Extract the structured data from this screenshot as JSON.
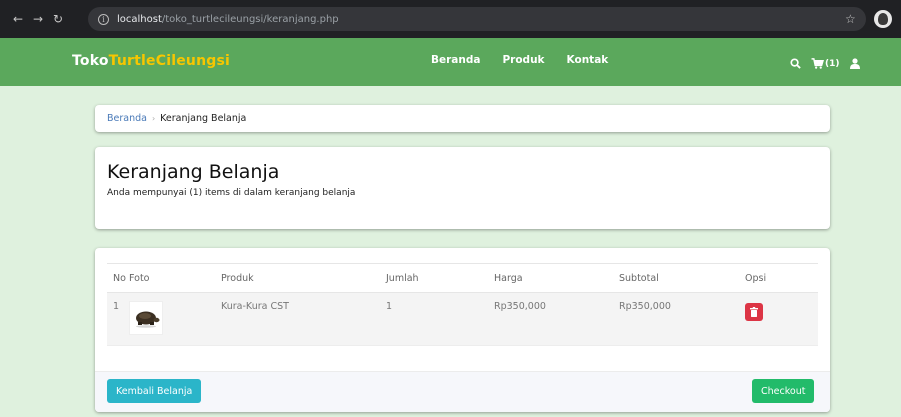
{
  "browser": {
    "url_host": "localhost",
    "url_path": "/toko_turtlecileungsi/keranjang.php"
  },
  "navbar": {
    "brand_part1": "Toko",
    "brand_part2": "TurtleCileungsi",
    "menu": [
      "Beranda",
      "Produk",
      "Kontak"
    ],
    "cart_count": "(1)"
  },
  "breadcrumb": {
    "home": "Beranda",
    "current": "Keranjang Belanja"
  },
  "page": {
    "title": "Keranjang Belanja",
    "subtitle": "Anda mempunyai (1) items di dalam keranjang belanja"
  },
  "table": {
    "headers": [
      "No",
      "Foto",
      "Produk",
      "Jumlah",
      "Harga",
      "Subtotal",
      "Opsi"
    ],
    "rows": [
      {
        "no": "1",
        "produk": "Kura-Kura CST",
        "jumlah": "1",
        "harga": "Rp350,000",
        "subtotal": "Rp350,000"
      }
    ]
  },
  "buttons": {
    "back": "Kembali Belanja",
    "checkout": "Checkout"
  },
  "colors": {
    "navbar": "#5ba85c",
    "brand_accent": "#f7c600",
    "page_bg": "#dff1de",
    "delete": "#dc3545",
    "back_button": "#2bb5c9",
    "checkout_button": "#22bb6a"
  },
  "icons": {
    "search": "search-icon",
    "cart": "cart-icon",
    "user": "user-icon",
    "delete": "trash-icon"
  }
}
